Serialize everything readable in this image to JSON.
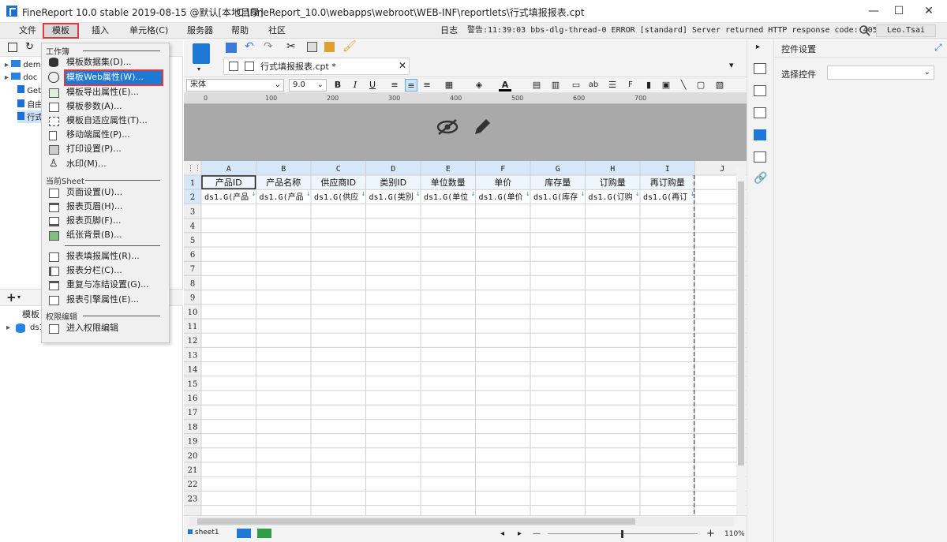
{
  "window": {
    "app_title": "FineReport 10.0 stable 2019-08-15 @默认[本地目录]",
    "file_path": "C:\\FineReport_10.0\\webapps\\webroot\\WEB-INF\\reportlets\\行式填报报表.cpt",
    "minimize": "—",
    "maximize": "☐",
    "close": "✕"
  },
  "menubar": {
    "items": [
      "文件",
      "模板",
      "插入",
      "单元格(C)",
      "服务器",
      "帮助",
      "社区"
    ],
    "log_label": "日志",
    "warning": "警告:11:39:03 bbs-dlg-thread-0 ERROR [standard] Server returned HTTP response code: 405 fo...",
    "user": "Leo.Tsai"
  },
  "left_panel": {
    "tree": [
      "dem",
      "doc",
      "Get",
      "自由",
      "行式"
    ],
    "bottom_tab": "模板",
    "dataset": "ds1"
  },
  "dropdown": {
    "section_workbook": "工作簿",
    "workbook_items": [
      "模板数据集(D)...",
      "模板Web属性(W)...",
      "模板导出属性(E)...",
      "模板参数(A)...",
      "模板自适应属性(T)...",
      "移动端属性(P)...",
      "打印设置(P)...",
      "水印(M)..."
    ],
    "section_sheet": "当前Sheet",
    "sheet_items": [
      "页面设置(U)...",
      "报表页眉(H)...",
      "报表页脚(F)...",
      "纸张背景(B)..."
    ],
    "report_items": [
      "报表填报属性(R)...",
      "报表分栏(C)...",
      "重复与冻结设置(G)...",
      "报表引擎属性(E)..."
    ],
    "section_perm": "权限编辑",
    "perm_items": [
      "进入权限编辑"
    ]
  },
  "editor": {
    "tab_label": "行式填报报表.cpt *",
    "font_name": "宋体",
    "font_size": "9.0",
    "ruler_marks": [
      "0",
      "100",
      "200",
      "300",
      "400",
      "500",
      "600",
      "700"
    ],
    "columns": [
      "A",
      "B",
      "C",
      "D",
      "E",
      "F",
      "G",
      "H",
      "I",
      "J"
    ],
    "row_count": 23,
    "row1": [
      "产品ID",
      "产品名称",
      "供应商ID",
      "类别ID",
      "单位数量",
      "单价",
      "库存量",
      "订购量",
      "再订购量"
    ],
    "row2": [
      "ds1.G(产品",
      "ds1.G(产品",
      "ds1.G(供应",
      "ds1.G(类别",
      "ds1.G(单位",
      "ds1.G(单价",
      "ds1.G(库存",
      "ds1.G(订购",
      "ds1.G(再订"
    ],
    "sheet_tab": "sheet1",
    "zoom_minus": "—",
    "zoom_plus": "+",
    "zoom": "110%"
  },
  "right_panel": {
    "title": "控件设置",
    "select_label": "选择控件",
    "select_value": ""
  },
  "colors": {
    "accent": "#1e78d6",
    "highlight_border": "#e0393e",
    "header_bg": "#a9a9a9"
  }
}
